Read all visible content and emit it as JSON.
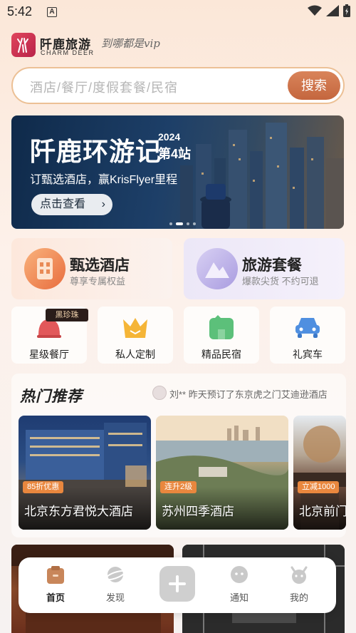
{
  "status_bar": {
    "time": "5:42",
    "notification_icon": "A"
  },
  "header": {
    "brand_cn": "阡鹿旅游",
    "brand_en": "CHARM DEER",
    "slogan": "到哪都是vip"
  },
  "search": {
    "placeholder": "酒店/餐厅/度假套餐/民宿",
    "button": "搜索"
  },
  "banner": {
    "title": "阡鹿环游记",
    "year": "2024",
    "station": "第4站",
    "subtitle": "订甄选酒店，赢KrisFlyer里程",
    "cta": "点击查看",
    "active_dot": 1,
    "dot_count": 4
  },
  "features": [
    {
      "title": "甄选酒店",
      "subtitle": "尊享专属权益",
      "icon": "hotel-building-icon"
    },
    {
      "title": "旅游套餐",
      "subtitle": "爆款尖货 不约可退",
      "icon": "mountain-icon"
    }
  ],
  "services": [
    {
      "label": "星级餐厅",
      "icon": "service-bell-icon",
      "badge": "黑珍珠"
    },
    {
      "label": "私人定制",
      "icon": "crown-icon"
    },
    {
      "label": "精品民宿",
      "icon": "house-icon"
    },
    {
      "label": "礼宾车",
      "icon": "car-icon"
    }
  ],
  "hot": {
    "title": "热门推荐",
    "ticker": "刘** 昨天预订了东京虎之门艾迪逊酒店",
    "cards": [
      {
        "tag": "85折优惠",
        "name": "北京东方君悦大酒店"
      },
      {
        "tag": "连升2级",
        "name": "苏州四季酒店"
      },
      {
        "tag": "立减1000",
        "name": "北京前门"
      }
    ]
  },
  "tabbar": {
    "tabs": [
      {
        "label": "首页",
        "icon": "home-icon",
        "active": true
      },
      {
        "label": "发现",
        "icon": "planet-icon",
        "active": false
      },
      {
        "label": "",
        "icon": "plus-icon",
        "active": false
      },
      {
        "label": "通知",
        "icon": "chat-icon",
        "active": false
      },
      {
        "label": "我的",
        "icon": "deer-face-icon",
        "active": false
      }
    ]
  },
  "colors": {
    "accent": "#c4663e",
    "tag": "#e9873e",
    "search_border": "#ecc095"
  }
}
